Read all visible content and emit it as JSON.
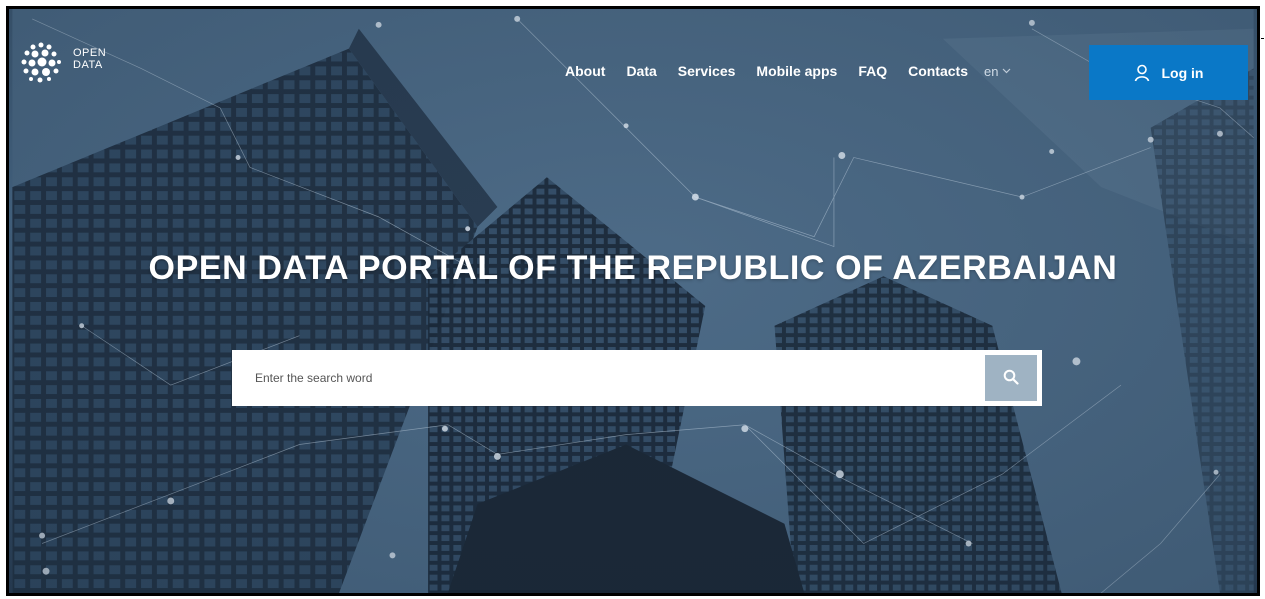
{
  "logo": {
    "line1": "OPEN",
    "line2": "DATA"
  },
  "nav": {
    "items": [
      {
        "label": "About"
      },
      {
        "label": "Data"
      },
      {
        "label": "Services"
      },
      {
        "label": "Mobile apps"
      },
      {
        "label": "FAQ"
      },
      {
        "label": "Contacts"
      }
    ],
    "language": "en"
  },
  "login": {
    "label": "Log in"
  },
  "hero": {
    "title": "OPEN DATA PORTAL OF THE REPUBLIC OF AZERBAIJAN"
  },
  "search": {
    "placeholder": "Enter the search word"
  },
  "colors": {
    "accent": "#0a78c7",
    "search_button": "#9fb3c3"
  },
  "icons": {
    "login": "user-icon",
    "search": "search-icon",
    "language": "chevron-down-icon"
  }
}
